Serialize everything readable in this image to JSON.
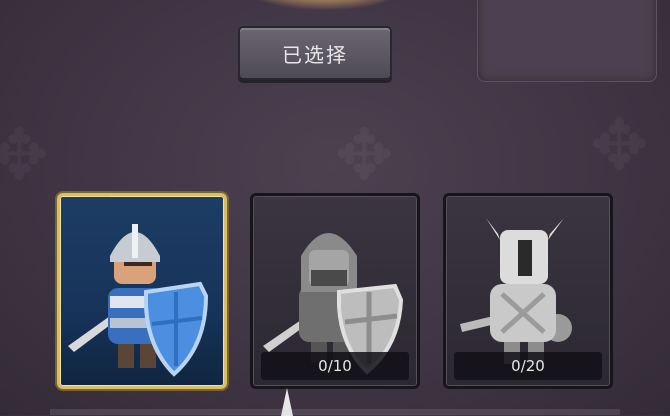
{
  "header": {
    "selected_button_label": "已选择"
  },
  "cards": [
    {
      "name": "blue-knight",
      "progress": null,
      "selected": true
    },
    {
      "name": "hooded-warrior",
      "progress": "0/10",
      "selected": false
    },
    {
      "name": "horned-knight",
      "progress": "0/20",
      "selected": false
    }
  ],
  "colors": {
    "background": "#3f3544",
    "selected_border": "#d9bf6a",
    "selected_card_bg": "#17335a",
    "locked_card_bg": "#2c2832"
  }
}
